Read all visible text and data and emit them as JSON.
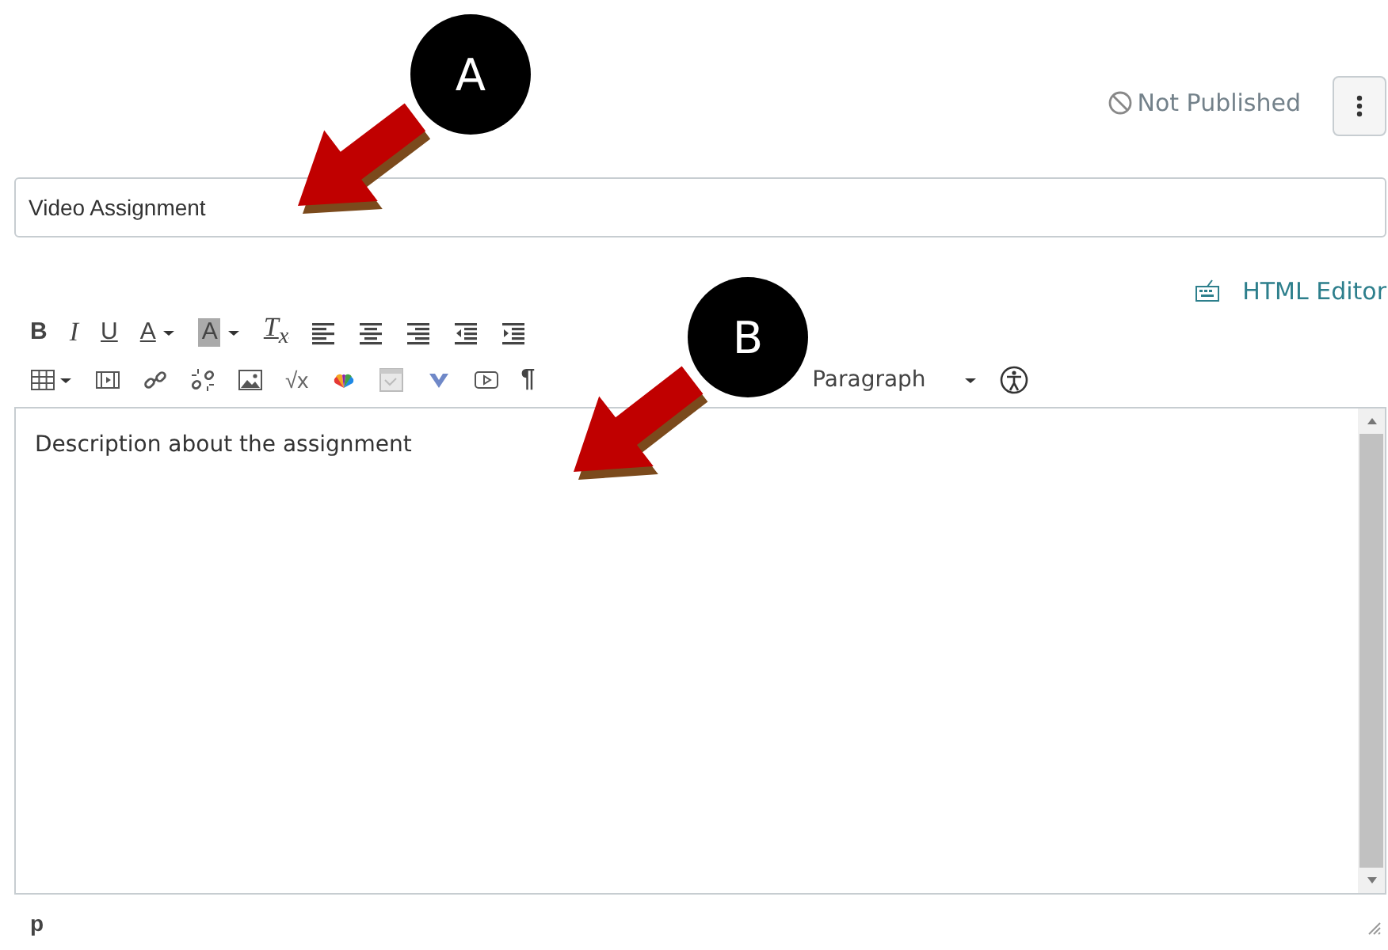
{
  "header": {
    "publish_status": "Not Published"
  },
  "title_field": {
    "value": "Video Assignment"
  },
  "editor_switch": {
    "label": "HTML Editor"
  },
  "toolbar": {
    "bold": "B",
    "italic": "I",
    "underline": "U",
    "text_color": "A",
    "background_color": "A",
    "clear_formatting": "T$_{x}$",
    "square_root": "√x",
    "paragraph_mark": "¶",
    "block_format": "Paragraph"
  },
  "editor": {
    "text": "Description about the assignment"
  },
  "status_bar": {
    "path": "p"
  },
  "callouts": [
    {
      "label": "A"
    },
    {
      "label": "B"
    }
  ]
}
